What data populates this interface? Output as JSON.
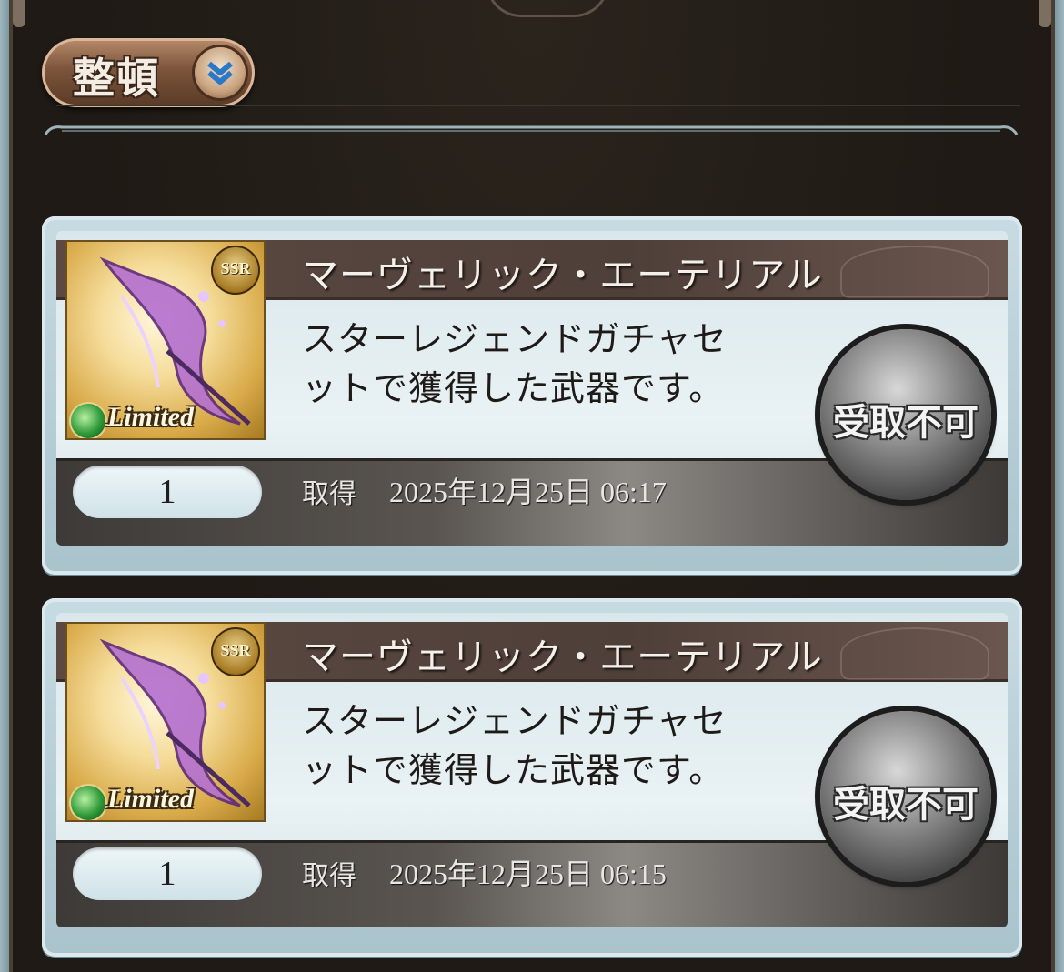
{
  "toolbar": {
    "sort_label": "整頓"
  },
  "items": [
    {
      "name": "マーヴェリック・エーテリアル",
      "rarity": "SSR",
      "tag": "Limited",
      "description": "スターレジェンドガチャセットで獲得した武器です。",
      "action_label": "受取不可",
      "quantity": "1",
      "acquired_label": "取得",
      "acquired_date": "2025年12月25日 06:17"
    },
    {
      "name": "マーヴェリック・エーテリアル",
      "rarity": "SSR",
      "tag": "Limited",
      "description": "スターレジェンドガチャセットで獲得した武器です。",
      "action_label": "受取不可",
      "quantity": "1",
      "acquired_label": "取得",
      "acquired_date": "2025年12月25日 06:15"
    }
  ],
  "colors": {
    "background": "#1f1a15",
    "title_bar": "#4f3f39",
    "card_frame": "#c7dbe2",
    "sort_button": "#7b543b",
    "element_wind": "#2f9a3a"
  },
  "icons": {
    "sort": "double-chevron-down-icon",
    "element": "wind-element-icon"
  }
}
